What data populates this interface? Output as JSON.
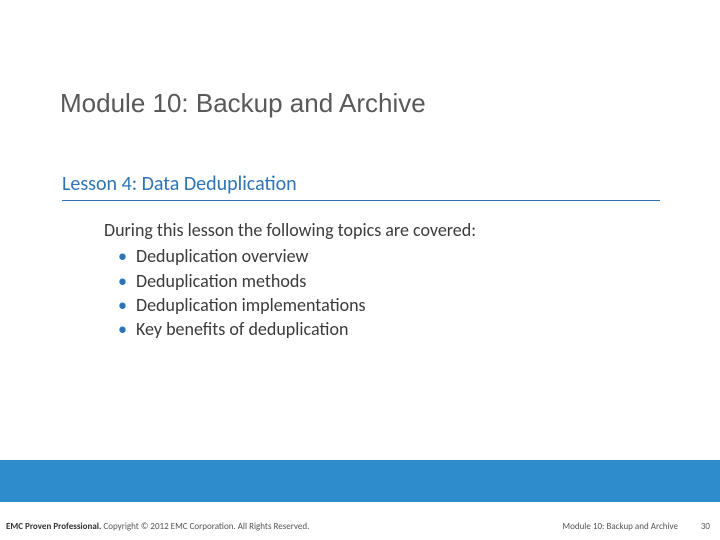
{
  "module_title": "Module 10: Backup and Archive",
  "lesson_title": "Lesson 4: Data Deduplication",
  "intro": "During this lesson the following topics are covered:",
  "topics": [
    "Deduplication overview",
    "Deduplication methods",
    "Deduplication implementations",
    "Key benefits of deduplication"
  ],
  "footer": {
    "left_bold": "EMC Proven Professional.",
    "left_rest": " Copyright © 2012 EMC Corporation. All Rights Reserved.",
    "mid": "Module 10: Backup and Archive",
    "page": "30"
  }
}
